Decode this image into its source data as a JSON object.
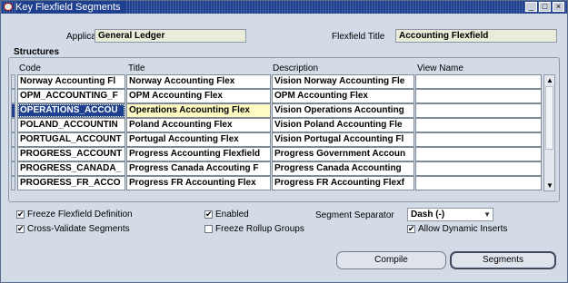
{
  "window": {
    "title": "Key Flexfield Segments"
  },
  "header": {
    "application_label": "Application",
    "application_value": "General Ledger",
    "flexfield_title_label": "Flexfield Title",
    "flexfield_title_value": "Accounting Flexfield"
  },
  "structures": {
    "group_label": "Structures",
    "columns": {
      "code": "Code",
      "title": "Title",
      "description": "Description",
      "view_name": "View Name"
    },
    "rows": [
      {
        "code": "Norway Accounting Fl",
        "title": "Norway Accounting Flex",
        "description": "Vision Norway Accounting Fle",
        "view_name": ""
      },
      {
        "code": "OPM_ACCOUNTING_F",
        "title": "OPM Accounting Flex",
        "description": "OPM Accounting Flex",
        "view_name": ""
      },
      {
        "code": "OPERATIONS_ACCOU",
        "title": "Operations Accounting Flex",
        "description": "Vision Operations Accounting",
        "view_name": ""
      },
      {
        "code": "POLAND_ACCOUNTIN",
        "title": "Poland Accounting Flex",
        "description": "Vision Poland Accounting Fle",
        "view_name": ""
      },
      {
        "code": "PORTUGAL_ACCOUNT",
        "title": "Portugal Accounting Flex",
        "description": "Vision Portugal Accounting Fl",
        "view_name": ""
      },
      {
        "code": "PROGRESS_ACCOUNT",
        "title": "Progress Accounting Flexfield",
        "description": "Progress Government Accoun",
        "view_name": ""
      },
      {
        "code": "PROGRESS_CANADA_",
        "title": "Progress Canada Accouting F",
        "description": "Progress Canada Accounting",
        "view_name": ""
      },
      {
        "code": "PROGRESS_FR_ACCO",
        "title": "Progress FR Accounting Flex",
        "description": "Progress FR Accounting Flexf",
        "view_name": ""
      }
    ]
  },
  "options": {
    "freeze_flexfield_definition": {
      "label": "Freeze Flexfield Definition",
      "checked": true
    },
    "cross_validate_segments": {
      "label": "Cross-Validate Segments",
      "checked": true
    },
    "enabled": {
      "label": "Enabled",
      "checked": true
    },
    "freeze_rollup_groups": {
      "label": "Freeze Rollup Groups",
      "checked": false
    },
    "segment_separator_label": "Segment Separator",
    "segment_separator_value": "Dash (-)",
    "allow_dynamic_inserts": {
      "label": "Allow Dynamic Inserts",
      "checked": true
    }
  },
  "buttons": {
    "compile": "Compile",
    "segments": "Segments"
  },
  "check_glyph": "✔"
}
